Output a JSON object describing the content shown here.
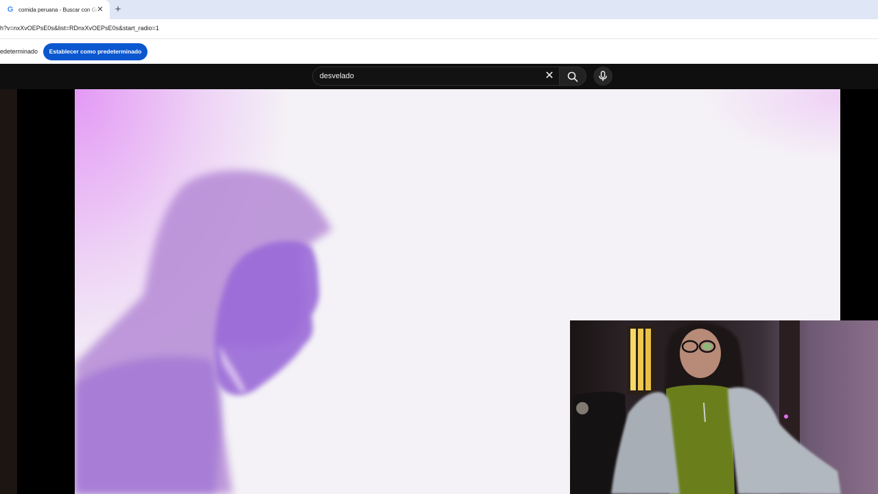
{
  "browser": {
    "tab_title": "comida peruana - Buscar con Google",
    "favicon_glyph": "G",
    "close_glyph": "✕",
    "new_tab_glyph": "+",
    "url": "h?v=nxXvOEPsE0s&list=RDnxXvOEPsE0s&start_radio=1"
  },
  "infobar": {
    "text": "edeterminado",
    "button_label": "Establecer como predeterminado",
    "button_color": "#0b57d0"
  },
  "youtube": {
    "search_value": "desvelado",
    "clear_glyph": "✕",
    "icons": [
      "close-icon",
      "search-icon",
      "microphone-icon"
    ]
  },
  "colors": {
    "header_bg": "#0f0f0f",
    "tab_strip_bg": "#dfe7f6",
    "video_accent": "#b27ae8"
  }
}
